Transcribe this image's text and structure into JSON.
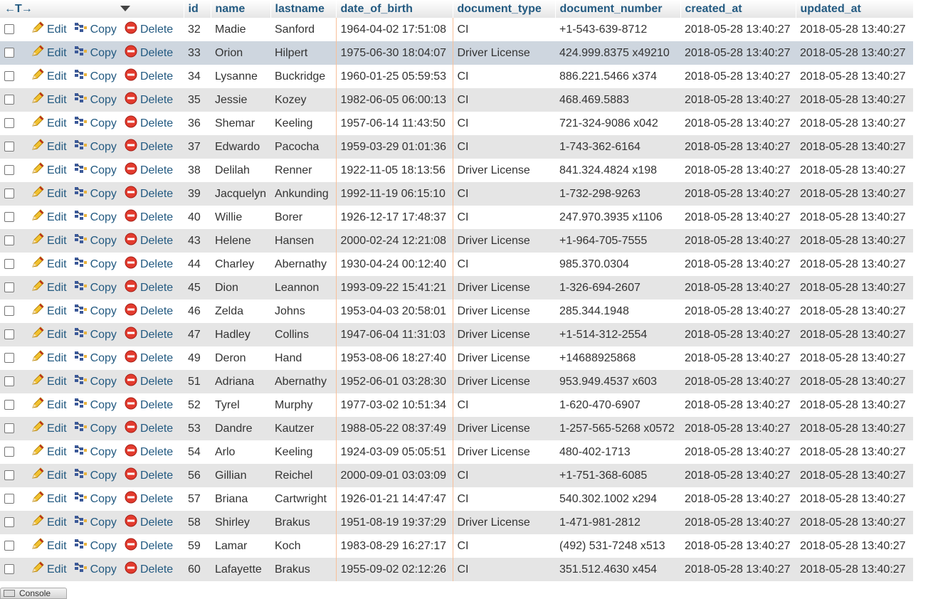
{
  "header": {
    "nav_arrows": "←T→",
    "columns": [
      "id",
      "name",
      "lastname",
      "date_of_birth",
      "document_type",
      "document_number",
      "created_at",
      "updated_at"
    ]
  },
  "actions": {
    "edit": "Edit",
    "copy": "Copy",
    "delete": "Delete"
  },
  "highlighted_row_id": "33",
  "rows": [
    {
      "id": "32",
      "name": "Madie",
      "lastname": "Sanford",
      "dob": "1964-04-02 17:51:08",
      "doc_type": "CI",
      "doc_number": "+1-543-639-8712",
      "created": "2018-05-28 13:40:27",
      "updated": "2018-05-28 13:40:27"
    },
    {
      "id": "33",
      "name": "Orion",
      "lastname": "Hilpert",
      "dob": "1975-06-30 18:04:07",
      "doc_type": "Driver License",
      "doc_number": "424.999.8375 x49210",
      "created": "2018-05-28 13:40:27",
      "updated": "2018-05-28 13:40:27"
    },
    {
      "id": "34",
      "name": "Lysanne",
      "lastname": "Buckridge",
      "dob": "1960-01-25 05:59:53",
      "doc_type": "CI",
      "doc_number": "886.221.5466 x374",
      "created": "2018-05-28 13:40:27",
      "updated": "2018-05-28 13:40:27"
    },
    {
      "id": "35",
      "name": "Jessie",
      "lastname": "Kozey",
      "dob": "1982-06-05 06:00:13",
      "doc_type": "CI",
      "doc_number": "468.469.5883",
      "created": "2018-05-28 13:40:27",
      "updated": "2018-05-28 13:40:27"
    },
    {
      "id": "36",
      "name": "Shemar",
      "lastname": "Keeling",
      "dob": "1957-06-14 11:43:50",
      "doc_type": "CI",
      "doc_number": "721-324-9086 x042",
      "created": "2018-05-28 13:40:27",
      "updated": "2018-05-28 13:40:27"
    },
    {
      "id": "37",
      "name": "Edwardo",
      "lastname": "Pacocha",
      "dob": "1959-03-29 01:01:36",
      "doc_type": "CI",
      "doc_number": "1-743-362-6164",
      "created": "2018-05-28 13:40:27",
      "updated": "2018-05-28 13:40:27"
    },
    {
      "id": "38",
      "name": "Delilah",
      "lastname": "Renner",
      "dob": "1922-11-05 18:13:56",
      "doc_type": "Driver License",
      "doc_number": "841.324.4824 x198",
      "created": "2018-05-28 13:40:27",
      "updated": "2018-05-28 13:40:27"
    },
    {
      "id": "39",
      "name": "Jacquelyn",
      "lastname": "Ankunding",
      "dob": "1992-11-19 06:15:10",
      "doc_type": "CI",
      "doc_number": "1-732-298-9263",
      "created": "2018-05-28 13:40:27",
      "updated": "2018-05-28 13:40:27"
    },
    {
      "id": "40",
      "name": "Willie",
      "lastname": "Borer",
      "dob": "1926-12-17 17:48:37",
      "doc_type": "CI",
      "doc_number": "247.970.3935 x1106",
      "created": "2018-05-28 13:40:27",
      "updated": "2018-05-28 13:40:27"
    },
    {
      "id": "43",
      "name": "Helene",
      "lastname": "Hansen",
      "dob": "2000-02-24 12:21:08",
      "doc_type": "Driver License",
      "doc_number": "+1-964-705-7555",
      "created": "2018-05-28 13:40:27",
      "updated": "2018-05-28 13:40:27"
    },
    {
      "id": "44",
      "name": "Charley",
      "lastname": "Abernathy",
      "dob": "1930-04-24 00:12:40",
      "doc_type": "CI",
      "doc_number": "985.370.0304",
      "created": "2018-05-28 13:40:27",
      "updated": "2018-05-28 13:40:27"
    },
    {
      "id": "45",
      "name": "Dion",
      "lastname": "Leannon",
      "dob": "1993-09-22 15:41:21",
      "doc_type": "Driver License",
      "doc_number": "1-326-694-2607",
      "created": "2018-05-28 13:40:27",
      "updated": "2018-05-28 13:40:27"
    },
    {
      "id": "46",
      "name": "Zelda",
      "lastname": "Johns",
      "dob": "1953-04-03 20:58:01",
      "doc_type": "Driver License",
      "doc_number": "285.344.1948",
      "created": "2018-05-28 13:40:27",
      "updated": "2018-05-28 13:40:27"
    },
    {
      "id": "47",
      "name": "Hadley",
      "lastname": "Collins",
      "dob": "1947-06-04 11:31:03",
      "doc_type": "Driver License",
      "doc_number": "+1-514-312-2554",
      "created": "2018-05-28 13:40:27",
      "updated": "2018-05-28 13:40:27"
    },
    {
      "id": "49",
      "name": "Deron",
      "lastname": "Hand",
      "dob": "1953-08-06 18:27:40",
      "doc_type": "Driver License",
      "doc_number": "+14688925868",
      "created": "2018-05-28 13:40:27",
      "updated": "2018-05-28 13:40:27"
    },
    {
      "id": "51",
      "name": "Adriana",
      "lastname": "Abernathy",
      "dob": "1952-06-01 03:28:30",
      "doc_type": "Driver License",
      "doc_number": "953.949.4537 x603",
      "created": "2018-05-28 13:40:27",
      "updated": "2018-05-28 13:40:27"
    },
    {
      "id": "52",
      "name": "Tyrel",
      "lastname": "Murphy",
      "dob": "1977-03-02 10:51:34",
      "doc_type": "CI",
      "doc_number": "1-620-470-6907",
      "created": "2018-05-28 13:40:27",
      "updated": "2018-05-28 13:40:27"
    },
    {
      "id": "53",
      "name": "Dandre",
      "lastname": "Kautzer",
      "dob": "1988-05-22 08:37:49",
      "doc_type": "Driver License",
      "doc_number": "1-257-565-5268 x0572",
      "created": "2018-05-28 13:40:27",
      "updated": "2018-05-28 13:40:27"
    },
    {
      "id": "54",
      "name": "Arlo",
      "lastname": "Keeling",
      "dob": "1924-03-09 05:05:51",
      "doc_type": "Driver License",
      "doc_number": "480-402-1713",
      "created": "2018-05-28 13:40:27",
      "updated": "2018-05-28 13:40:27"
    },
    {
      "id": "56",
      "name": "Gillian",
      "lastname": "Reichel",
      "dob": "2000-09-01 03:03:09",
      "doc_type": "CI",
      "doc_number": "+1-751-368-6085",
      "created": "2018-05-28 13:40:27",
      "updated": "2018-05-28 13:40:27"
    },
    {
      "id": "57",
      "name": "Briana",
      "lastname": "Cartwright",
      "dob": "1926-01-21 14:47:47",
      "doc_type": "CI",
      "doc_number": "540.302.1002 x294",
      "created": "2018-05-28 13:40:27",
      "updated": "2018-05-28 13:40:27"
    },
    {
      "id": "58",
      "name": "Shirley",
      "lastname": "Brakus",
      "dob": "1951-08-19 19:37:29",
      "doc_type": "Driver License",
      "doc_number": "1-471-981-2812",
      "created": "2018-05-28 13:40:27",
      "updated": "2018-05-28 13:40:27"
    },
    {
      "id": "59",
      "name": "Lamar",
      "lastname": "Koch",
      "dob": "1983-08-29 16:27:17",
      "doc_type": "CI",
      "doc_number": "(492) 531-7248 x513",
      "created": "2018-05-28 13:40:27",
      "updated": "2018-05-28 13:40:27"
    },
    {
      "id": "60",
      "name": "Lafayette",
      "lastname": "Brakus",
      "dob": "1955-09-02 02:12:26",
      "doc_type": "CI",
      "doc_number": "351.512.4630 x454",
      "created": "2018-05-28 13:40:27",
      "updated": "2018-05-28 13:40:27"
    }
  ],
  "console": {
    "label": "Console"
  },
  "icons": {
    "edit": "pencil-icon",
    "copy": "copy-icon",
    "delete": "delete-icon"
  },
  "colors": {
    "link": "#235a81",
    "highlight_row": "#ced6df",
    "even_row": "#e5e5e5",
    "dob_border": "#f7c09a"
  }
}
